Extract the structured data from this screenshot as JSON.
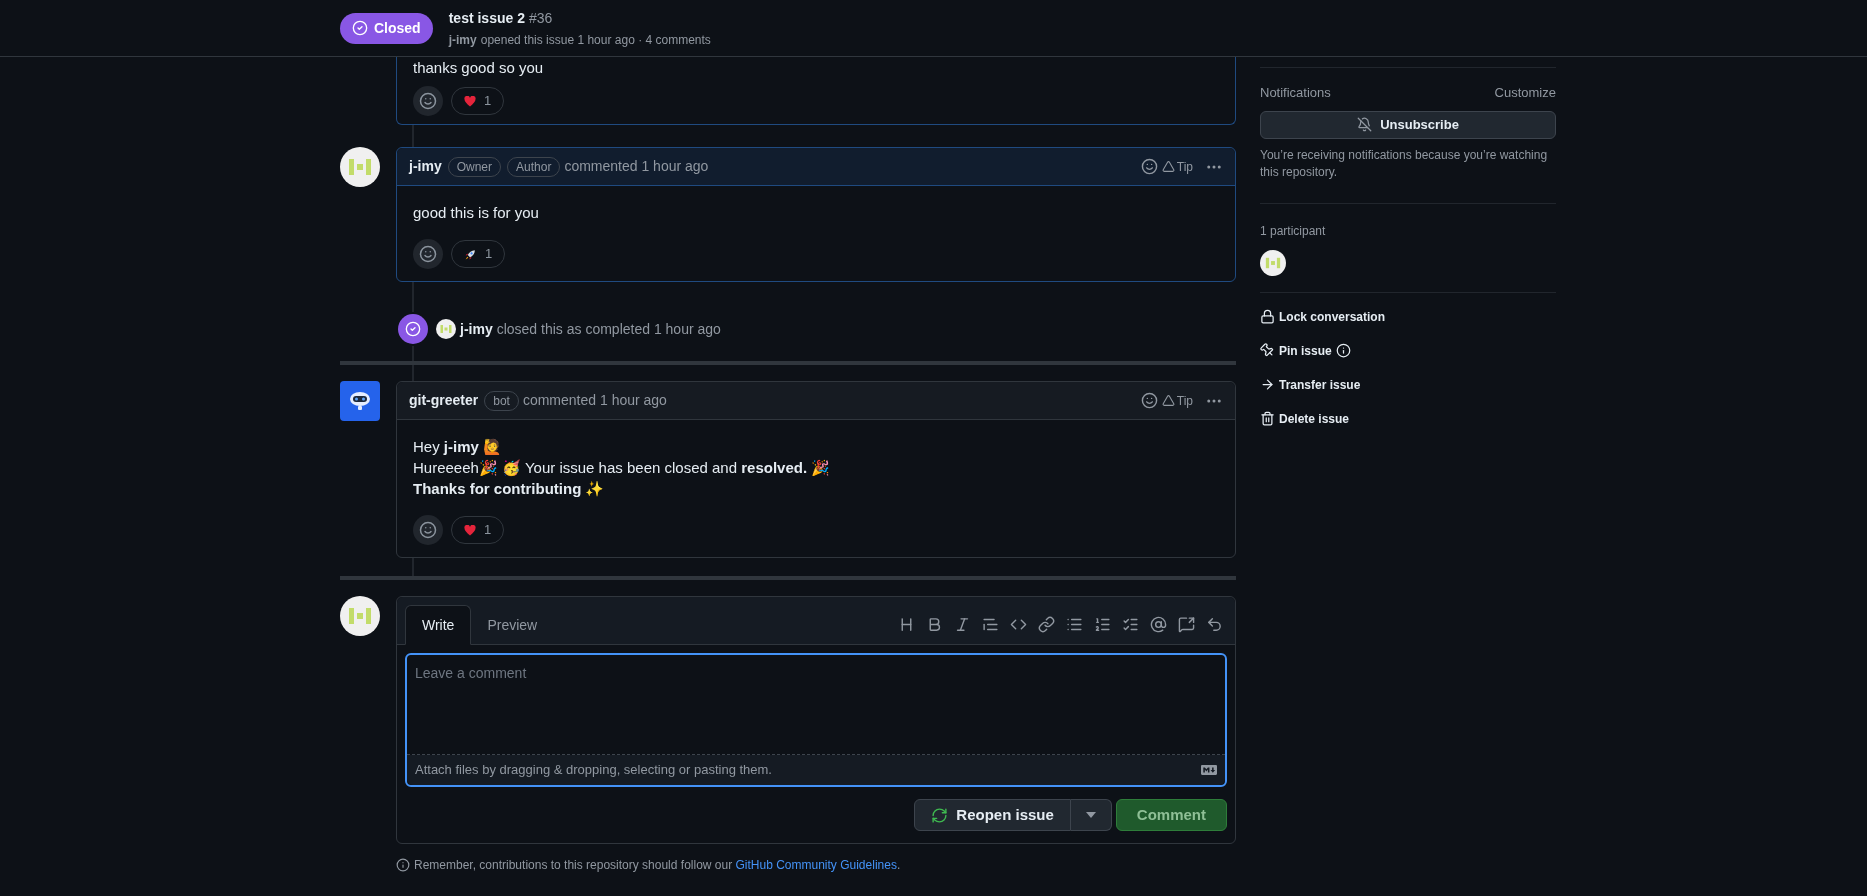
{
  "header": {
    "status": "Closed",
    "title": "test issue 2",
    "number": "#36",
    "author": "j-imy",
    "meta": "opened this issue 1 hour ago · 4 comments"
  },
  "timeline": [
    {
      "kind": "comment_tail",
      "highlighted": true,
      "body": [
        "thanks good so you"
      ],
      "reactions": [
        {
          "kind": "heart",
          "count": "1"
        }
      ]
    },
    {
      "kind": "comment",
      "avatar": {
        "kind": "identicon"
      },
      "highlighted": true,
      "author": "j-imy",
      "badges": [
        "Owner",
        "Author"
      ],
      "action": "commented 1 hour ago",
      "tip": "Tip",
      "body": [
        "good this is for you"
      ],
      "reactions": [
        {
          "kind": "rocket",
          "count": "1"
        }
      ]
    },
    {
      "kind": "event",
      "actor": "j-imy",
      "text": "closed this as completed 1 hour ago"
    },
    {
      "kind": "divider"
    },
    {
      "kind": "comment",
      "avatar": {
        "kind": "bot"
      },
      "highlighted": false,
      "author": "git-greeter",
      "badges": [
        "bot"
      ],
      "action": "commented 1 hour ago",
      "tip": "Tip",
      "body": [
        "Hey **j-imy** 🙋",
        "Hureeeeh🎉 🥳 Your issue has been closed and **resolved.** 🎉",
        "**Thanks for contributing** ✨"
      ],
      "reactions": [
        {
          "kind": "heart",
          "count": "1"
        }
      ]
    },
    {
      "kind": "divider"
    }
  ],
  "composer": {
    "tabs": [
      {
        "label": "Write",
        "selected": true
      },
      {
        "label": "Preview",
        "selected": false
      }
    ],
    "placeholder": "Leave a comment",
    "attach_hint": "Attach files by dragging & dropping, selecting or pasting them.",
    "reopen_button": "Reopen issue",
    "comment_button": "Comment"
  },
  "guidelines": {
    "text": "Remember, contributions to this repository should follow our ",
    "link": "GitHub Community Guidelines",
    "end": "."
  },
  "sidebar": {
    "notifications": {
      "label": "Notifications",
      "customize": "Customize",
      "button": "Unsubscribe",
      "notice": "You’re receiving notifications because you’re watching this repository."
    },
    "participants": {
      "label": "1 participant"
    },
    "actions": [
      {
        "kind": "lock",
        "label": "Lock conversation"
      },
      {
        "kind": "pin",
        "label": "Pin issue"
      },
      {
        "kind": "transfer",
        "label": "Transfer issue"
      },
      {
        "kind": "delete",
        "label": "Delete issue"
      }
    ]
  }
}
